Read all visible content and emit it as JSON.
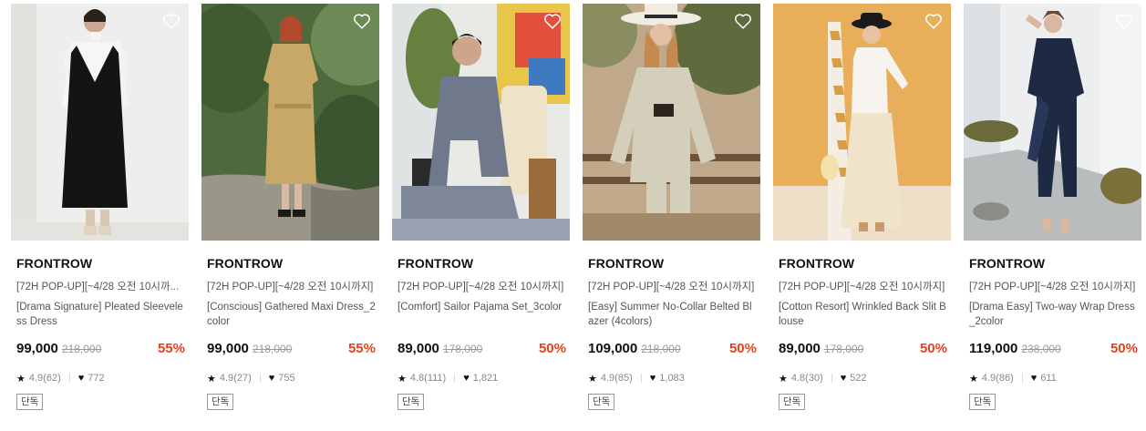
{
  "products": [
    {
      "brand": "FRONTROW",
      "promo": "[72H POP-UP][~4/28 오전 10시까...",
      "name": "[Drama Signature] Pleated Sleeveless Dress",
      "price": "99,000",
      "original_price": "218,000",
      "discount": "55%",
      "rating": "4.9(62)",
      "likes": "772",
      "badge": "단독",
      "image": "model-black-sleeveless-dress"
    },
    {
      "brand": "FRONTROW",
      "promo": "[72H POP-UP][~4/28 오전 10시까지]",
      "name": "[Conscious] Gathered Maxi Dress_2color",
      "price": "99,000",
      "original_price": "218,000",
      "discount": "55%",
      "rating": "4.9(27)",
      "likes": "755",
      "badge": "단독",
      "image": "model-khaki-maxi-dress"
    },
    {
      "brand": "FRONTROW",
      "promo": "[72H POP-UP][~4/28 오전 10시까지]",
      "name": "[Comfort] Sailor Pajama Set_3color",
      "price": "89,000",
      "original_price": "178,000",
      "discount": "50%",
      "rating": "4.8(111)",
      "likes": "1,821",
      "badge": "단독",
      "image": "model-grey-pajama-set"
    },
    {
      "brand": "FRONTROW",
      "promo": "[72H POP-UP][~4/28 오전 10시까지]",
      "name": "[Easy] Summer No-Collar Belted Blazer (4colors)",
      "price": "109,000",
      "original_price": "218,000",
      "discount": "50%",
      "rating": "4.9(85)",
      "likes": "1,083",
      "badge": "단독",
      "image": "model-beige-blazer"
    },
    {
      "brand": "FRONTROW",
      "promo": "[72H POP-UP][~4/28 오전 10시까지]",
      "name": "[Cotton Resort] Wrinkled Back Slit Blouse",
      "price": "89,000",
      "original_price": "178,000",
      "discount": "50%",
      "rating": "4.8(30)",
      "likes": "522",
      "badge": "단독",
      "image": "model-white-blouse"
    },
    {
      "brand": "FRONTROW",
      "promo": "[72H POP-UP][~4/28 오전 10시까지]",
      "name": "[Drama Easy] Two-way Wrap Dress_2color",
      "price": "119,000",
      "original_price": "238,000",
      "discount": "50%",
      "rating": "4.9(86)",
      "likes": "611",
      "badge": "단독",
      "image": "model-navy-wrap-dress"
    }
  ],
  "icons": {
    "wishlist": "heart-outline-icon",
    "rating": "star-icon",
    "likes": "heart-icon"
  },
  "colors": {
    "discount": "#e8401c",
    "text": "#111111",
    "muted": "#888888"
  }
}
